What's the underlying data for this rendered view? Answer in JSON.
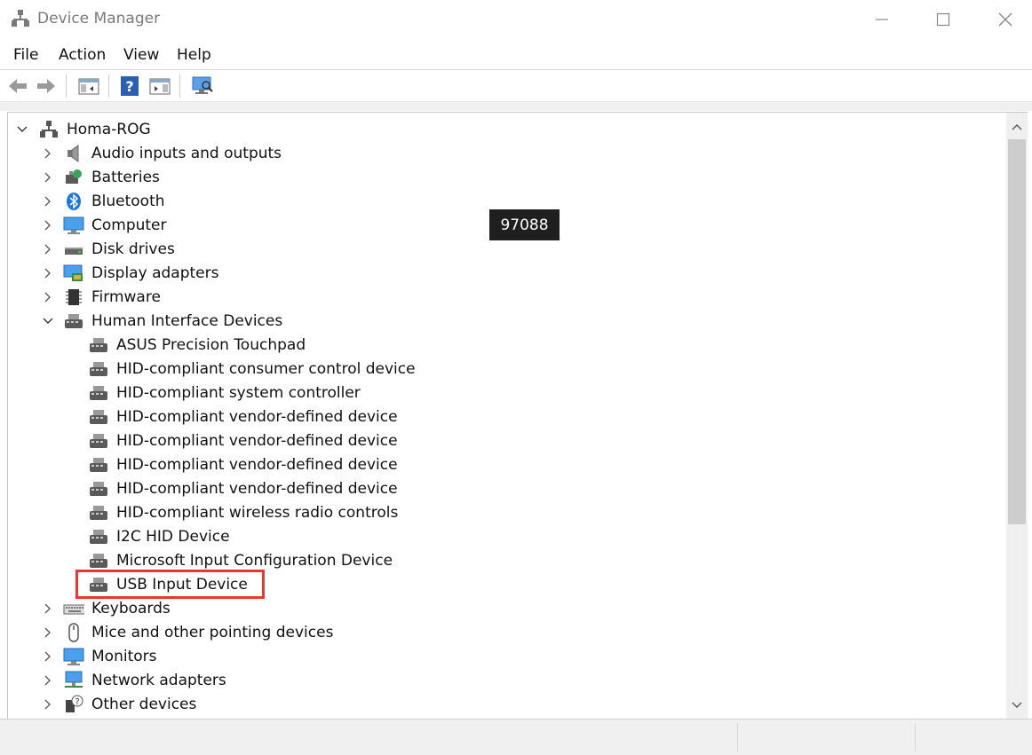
{
  "window": {
    "title": "Device Manager"
  },
  "menu": [
    "File",
    "Action",
    "View",
    "Help"
  ],
  "tree": {
    "root": "Homa-ROG",
    "categories": [
      {
        "label": "Audio inputs and outputs",
        "icon": "speaker-icon"
      },
      {
        "label": "Batteries",
        "icon": "battery-icon"
      },
      {
        "label": "Bluetooth",
        "icon": "bluetooth-icon"
      },
      {
        "label": "Computer",
        "icon": "monitor-icon"
      },
      {
        "label": "Disk drives",
        "icon": "disk-drive-icon"
      },
      {
        "label": "Display adapters",
        "icon": "display-adapter-icon"
      },
      {
        "label": "Firmware",
        "icon": "firmware-chip-icon"
      },
      {
        "label": "Human Interface Devices",
        "icon": "hid-icon",
        "expanded": true
      }
    ],
    "hid_children": [
      "ASUS Precision Touchpad",
      "HID-compliant consumer control device",
      "HID-compliant system controller",
      "HID-compliant vendor-defined device",
      "HID-compliant vendor-defined device",
      "HID-compliant vendor-defined device",
      "HID-compliant vendor-defined device",
      "HID-compliant wireless radio controls",
      "I2C HID Device",
      "Microsoft Input Configuration Device",
      "USB Input Device"
    ],
    "more_categories": [
      {
        "label": "Keyboards",
        "icon": "keyboard-icon"
      },
      {
        "label": "Mice and other pointing devices",
        "icon": "mouse-icon"
      },
      {
        "label": "Monitors",
        "icon": "monitor-icon"
      },
      {
        "label": "Network adapters",
        "icon": "network-adapter-icon"
      },
      {
        "label": "Other devices",
        "icon": "unknown-device-icon"
      }
    ]
  },
  "badge": "97088",
  "colors": {
    "highlight": "#e53935",
    "accent": "#1e78d7"
  }
}
